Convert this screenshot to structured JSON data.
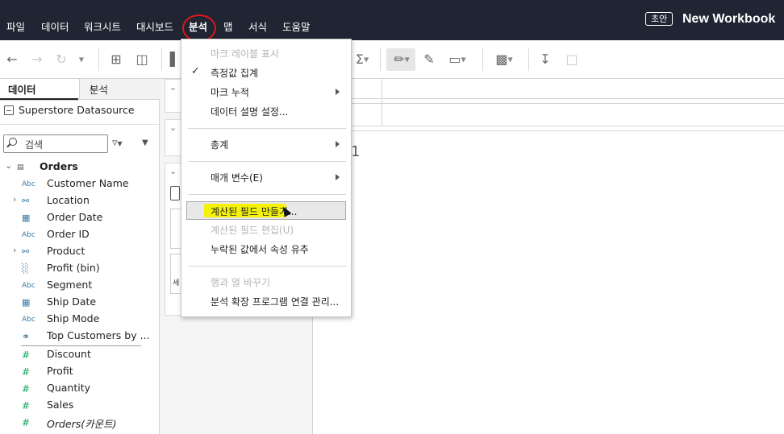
{
  "menubar": {
    "items": [
      "파일",
      "데이터",
      "워크시트",
      "대시보드",
      "분석",
      "맵",
      "서식",
      "도움말"
    ],
    "active_item": "분석",
    "draft_badge": "초안",
    "workbook_title": "New Workbook"
  },
  "colors": {
    "menubar_bg": "#1f2532",
    "dimension_icon": "#3a7aa5",
    "measure_icon": "#19a55d",
    "annotation_circle": "#e2141a",
    "highlight": "#f4f20a"
  },
  "data_pane": {
    "tab_data": "데이터",
    "tab_analysis": "분석",
    "datasource_name": "Superstore Datasource",
    "search_placeholder": "검색",
    "table_name": "Orders",
    "dimensions": [
      {
        "icon": "Abc",
        "label": "Customer Name",
        "expandable": false
      },
      {
        "icon": "hierarchy-icon",
        "label": "Location",
        "expandable": true
      },
      {
        "icon": "calendar-icon",
        "label": "Order Date",
        "expandable": false
      },
      {
        "icon": "Abc",
        "label": "Order ID",
        "expandable": false
      },
      {
        "icon": "hierarchy-icon",
        "label": "Product",
        "expandable": true
      },
      {
        "icon": "bin-icon",
        "label": "Profit (bin)",
        "expandable": false
      },
      {
        "icon": "Abc",
        "label": "Segment",
        "expandable": false
      },
      {
        "icon": "calendar-icon",
        "label": "Ship Date",
        "expandable": false
      },
      {
        "icon": "Abc",
        "label": "Ship Mode",
        "expandable": false
      },
      {
        "icon": "set-icon",
        "label": "Top Customers by ...",
        "expandable": false
      }
    ],
    "measures": [
      {
        "icon": "#",
        "label": "Discount"
      },
      {
        "icon": "#",
        "label": "Profit"
      },
      {
        "icon": "#",
        "label": "Quantity"
      },
      {
        "icon": "#",
        "label": "Sales"
      },
      {
        "icon": "#",
        "label": "Orders(카운트)"
      }
    ]
  },
  "cards_pane": {
    "marks_label_fragment": "세"
  },
  "viz": {
    "number": "1"
  },
  "analysis_menu": {
    "items": [
      {
        "label": "마크 레이블 표시",
        "disabled": true,
        "checked": false,
        "submenu": false
      },
      {
        "label": "측정값 집계",
        "disabled": false,
        "checked": true,
        "submenu": false
      },
      {
        "label": "마크 누적",
        "disabled": false,
        "checked": false,
        "submenu": true
      },
      {
        "label": "데이터 설명 설정...",
        "disabled": false,
        "checked": false,
        "submenu": false
      },
      {
        "label": "총계",
        "disabled": false,
        "checked": false,
        "submenu": true
      },
      {
        "label": "매개 변수(E)",
        "disabled": false,
        "checked": false,
        "submenu": true
      },
      {
        "label": "계산된 필드 만들기...",
        "disabled": false,
        "checked": false,
        "submenu": false
      },
      {
        "label": "계산된 필드 편집(U)",
        "disabled": true,
        "checked": false,
        "submenu": false
      },
      {
        "label": "누락된 값에서 속성 유추",
        "disabled": false,
        "checked": false,
        "submenu": false
      },
      {
        "label": "행과 열 바꾸기",
        "disabled": true,
        "checked": false,
        "submenu": false
      },
      {
        "label": "분석 확장 프로그램 연결 관리...",
        "disabled": false,
        "checked": false,
        "submenu": false
      }
    ],
    "hovered_item": "계산된 필드 만들기..."
  }
}
